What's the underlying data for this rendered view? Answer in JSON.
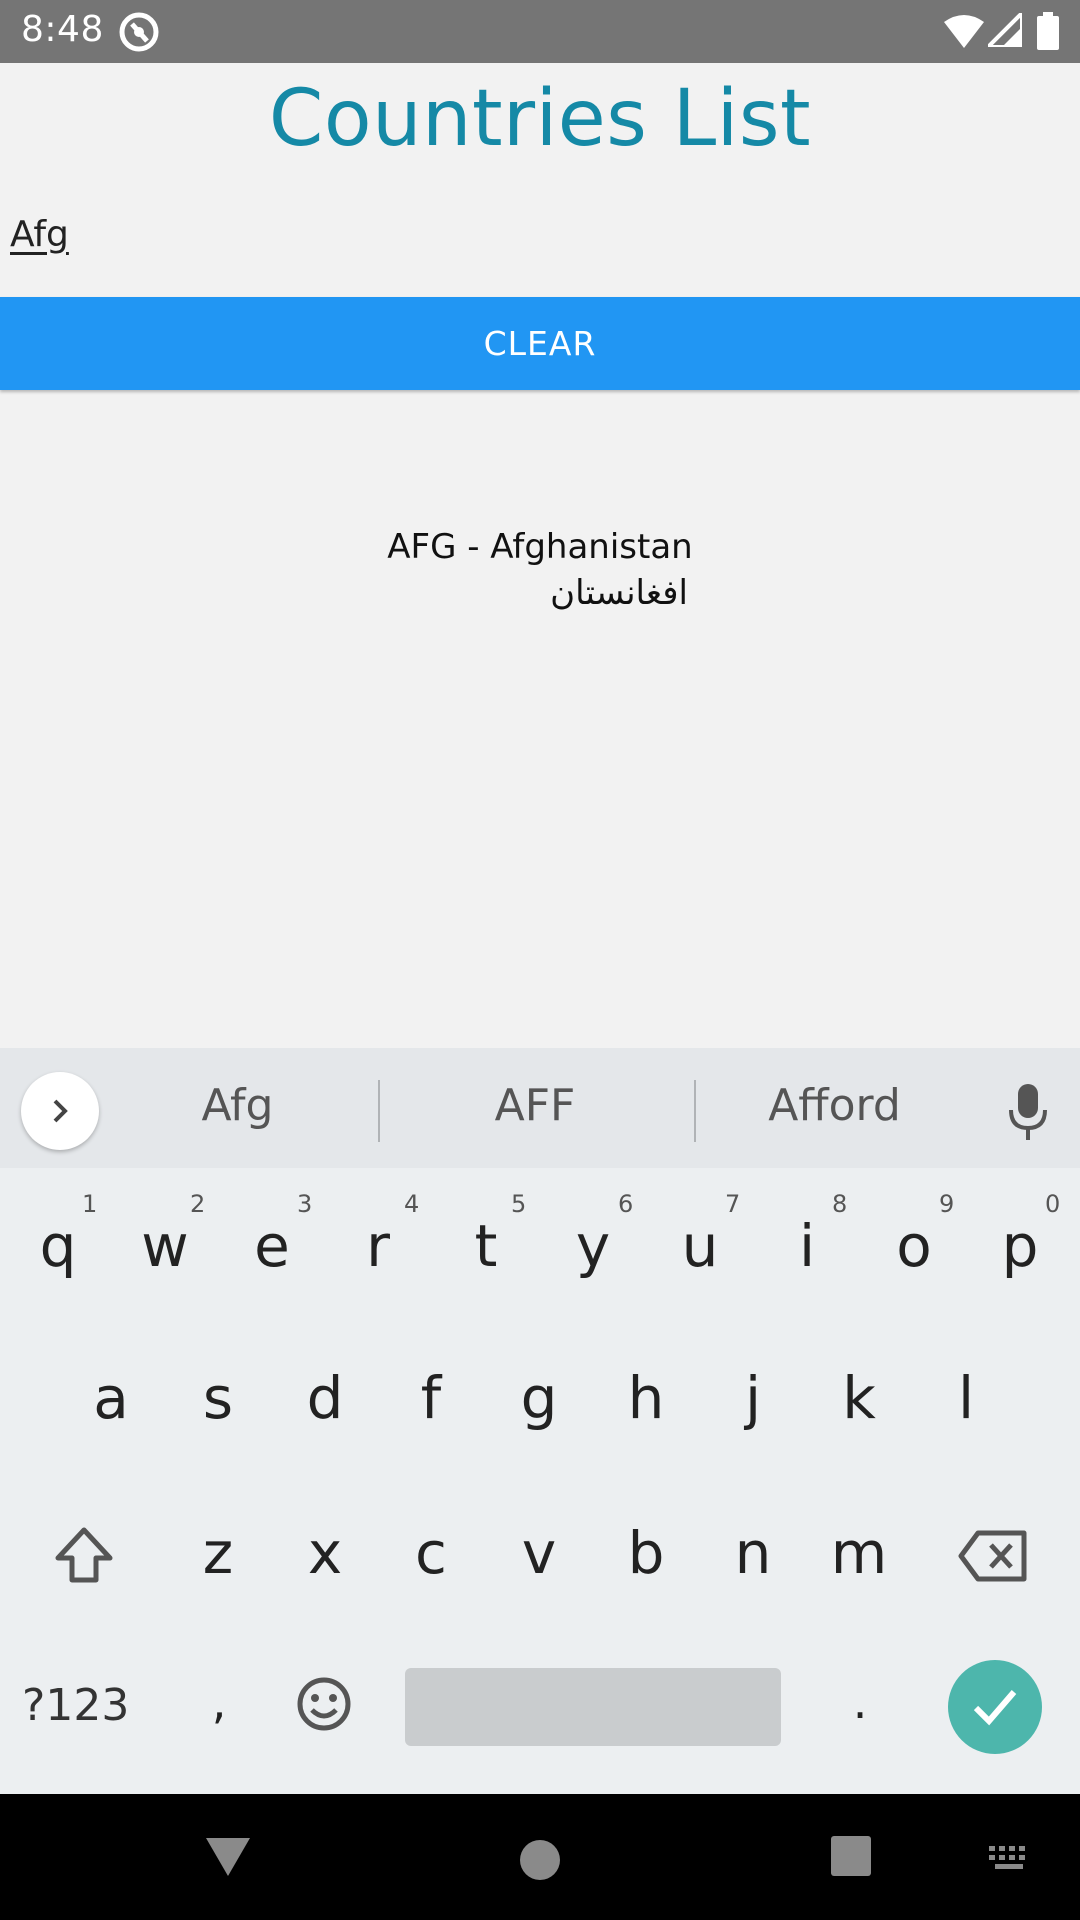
{
  "status_bar": {
    "time": "8:48",
    "icons": [
      "at-sign-icon",
      "wifi-icon",
      "signal-icon",
      "battery-icon"
    ]
  },
  "app": {
    "title": "Countries List",
    "search": {
      "value": "Afg"
    },
    "clear_button": "CLEAR",
    "results": [
      {
        "name": "AFG - Afghanistan",
        "native": "افغانستان"
      }
    ],
    "colors": {
      "title": "#1589a6",
      "button": "#2196f3"
    }
  },
  "keyboard": {
    "suggestions": [
      "Afg",
      "AFF",
      "Afford"
    ],
    "row1": [
      "q",
      "w",
      "e",
      "r",
      "t",
      "y",
      "u",
      "i",
      "o",
      "p"
    ],
    "row1_hints": [
      "1",
      "2",
      "3",
      "4",
      "5",
      "6",
      "7",
      "8",
      "9",
      "0"
    ],
    "row2": [
      "a",
      "s",
      "d",
      "f",
      "g",
      "h",
      "j",
      "k",
      "l"
    ],
    "row3": [
      "z",
      "x",
      "c",
      "v",
      "b",
      "n",
      "m"
    ],
    "symbols_label": "?123",
    "comma": ",",
    "period": ".",
    "enter_color": "#4db6ac"
  },
  "nav_bar": {
    "icons": [
      "back-icon",
      "home-icon",
      "recents-icon",
      "keyboard-switch-icon"
    ]
  }
}
